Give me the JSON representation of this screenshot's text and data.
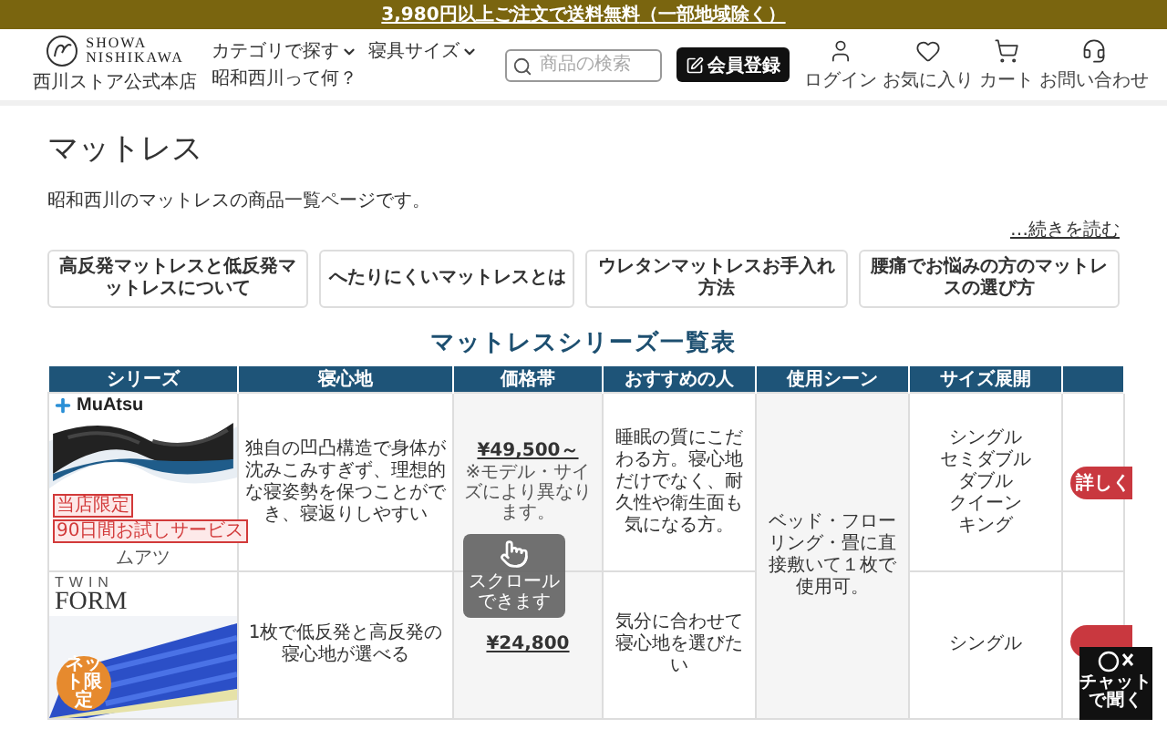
{
  "promo_banner": {
    "text": "3,980円以上ご注文で送料無料",
    "note": "（一部地域除く）"
  },
  "header": {
    "brand_lines": [
      "SHOWA",
      "NISHIKAWA"
    ],
    "store_name": "西川ストア公式本店",
    "nav": [
      {
        "label": "カテゴリで探す",
        "kind": "dropdown"
      },
      {
        "label": "寝具サイズ",
        "kind": "dropdown"
      },
      {
        "label": "昭和西川って何？",
        "kind": "link"
      }
    ],
    "search": {
      "placeholder": "商品の検索"
    },
    "register_button": "会員登録",
    "icon_links": [
      {
        "label": "ログイン",
        "kind": "user"
      },
      {
        "label": "お気に入り",
        "kind": "heart"
      },
      {
        "label": "カート",
        "kind": "cart"
      },
      {
        "label": "お問い合わせ",
        "kind": "support"
      }
    ]
  },
  "page": {
    "title": "マットレス",
    "description": "昭和西川のマットレスの商品一覧ページです。",
    "read_more": "…続きを読む",
    "guide_links": [
      "高反発マットレスと低反発マットレスについて",
      "へたりにくいマットレスとは",
      "ウレタンマットレスお手入れ方法",
      "腰痛でお悩みの方のマットレスの選び方"
    ]
  },
  "series_table": {
    "title": "マットレスシリーズ一覧表",
    "columns": [
      "シリーズ",
      "寝心地",
      "価格帯",
      "おすすめの人",
      "使用シーン",
      "サイズ展開"
    ],
    "scene": "ベッド・フローリング・畳に直接敷いて１枚で使用可。",
    "rows": [
      {
        "logo": "MuAtsu",
        "badges": [
          "当店限定",
          "90日間お試しサービス"
        ],
        "name": "ムアツ",
        "feel": "独自の凹凸構造で身体が沈みこみすぎず、理想的な寝姿勢を保つことができ、寝返りしやすい",
        "price": "¥49,500～",
        "price_note": "※モデル・サイズにより異なります。",
        "recommend": "睡眠の質にこだわる方。寝心地だけでなく、耐久性や衛生面も気になる方。",
        "sizes": [
          "シングル",
          "セミダブル",
          "ダブル",
          "クイーン",
          "キング"
        ],
        "details_button": "詳しく"
      },
      {
        "logo_top": "TWIN",
        "logo": "FORM",
        "corner_badge": "ネット限定",
        "feel": "1枚で低反発と高反発の寝心地が選べる",
        "price": "¥24,800",
        "recommend": "気分に合わせて寝心地を選びたい",
        "sizes": [
          "シングル"
        ]
      }
    ]
  },
  "scroll_hint": "スクロールできます",
  "chat_button": "チャットで聞く"
}
